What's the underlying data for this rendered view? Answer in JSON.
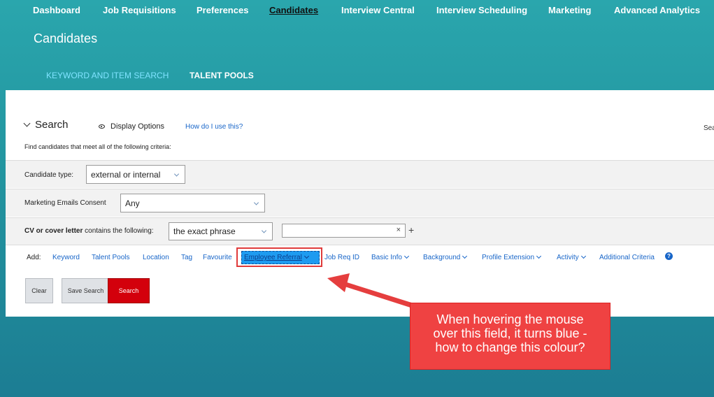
{
  "nav": {
    "items": [
      "Dashboard",
      "Job Requisitions",
      "Preferences",
      "Candidates",
      "Interview Central",
      "Interview Scheduling",
      "Marketing",
      "Advanced Analytics"
    ],
    "active": "Candidates"
  },
  "page": {
    "title": "Candidates"
  },
  "tabs": [
    "KEYWORD AND ITEM SEARCH",
    "TALENT POOLS"
  ],
  "search": {
    "heading": "Search",
    "display_options": "Display Options",
    "how_to": "How do I use this?",
    "right_cut_text": "Sea",
    "intro": "Find candidates that meet all of the following criteria:",
    "candidate_type": {
      "label": "Candidate type:",
      "value": "external or internal"
    },
    "marketing_consent": {
      "label": "Marketing Emails Consent",
      "value": "Any"
    },
    "cv": {
      "label_bold": "CV or cover letter",
      "label_rest": " contains the following:",
      "match_value": "the exact phrase",
      "text_value": "",
      "clear_icon": "×",
      "add_icon": "+"
    }
  },
  "add_bar": {
    "label": "Add:",
    "items": [
      "Keyword",
      "Talent Pools",
      "Location",
      "Tag",
      "Favourite",
      "Employee Referral",
      "Job Req ID",
      "Basic Info",
      "Background",
      "Profile Extension",
      "Activity",
      "Additional Criteria"
    ],
    "hovered": "Employee Referral",
    "help_icon": "?"
  },
  "buttons": {
    "clear": "Clear",
    "save_search": "Save Search",
    "search": "Search"
  },
  "annotation": {
    "lines": [
      "When hovering the mouse",
      "over this field, it turns blue -",
      "how to change this colour?"
    ]
  },
  "colors": {
    "accent_red": "#d3000c",
    "hover_blue": "#1e9bf0",
    "callout": "#ef4242",
    "teal": "#22949f"
  }
}
